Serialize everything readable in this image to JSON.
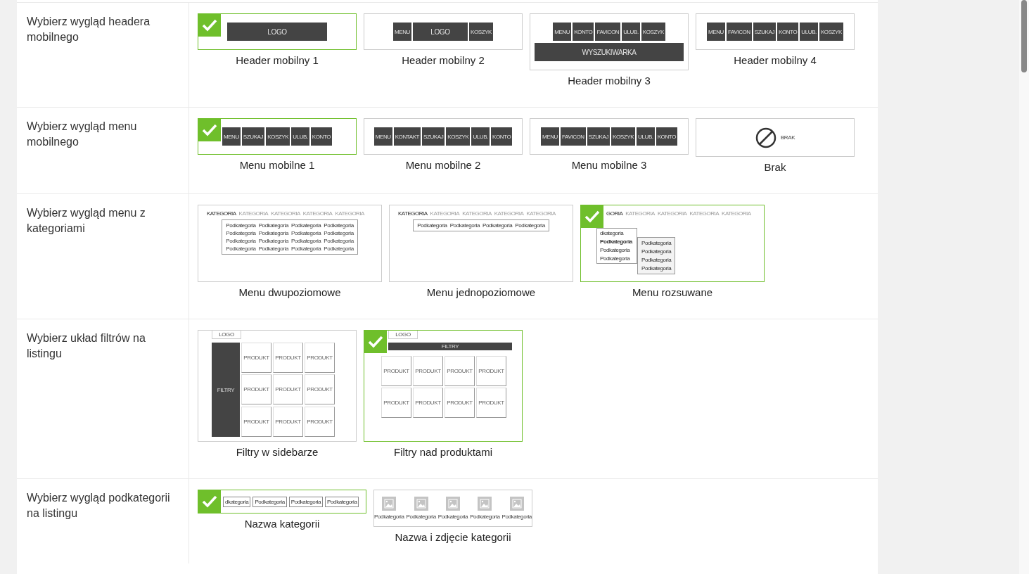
{
  "sections": [
    {
      "label": "Wybierz wygląd headera mobilnego",
      "options": [
        {
          "caption": "Header mobilny 1",
          "selected": true,
          "preview": {
            "kind": "blocks",
            "blocks": [
              {
                "text": "LOGO",
                "wide": true
              }
            ]
          }
        },
        {
          "caption": "Header mobilny 2",
          "selected": false,
          "preview": {
            "kind": "blocks",
            "blocks": [
              {
                "text": "MENU",
                "wide": false
              },
              {
                "text": "LOGO",
                "wide": true
              },
              {
                "text": "KOSZYK",
                "wide": false
              }
            ]
          }
        },
        {
          "caption": "Header mobilny 3",
          "selected": false,
          "preview": {
            "kind": "blocks",
            "blocks": [
              {
                "text": "MENU",
                "wide": false
              },
              {
                "text": "KONTO",
                "wide": false
              },
              {
                "text": "FAVICON",
                "wide": false
              },
              {
                "text": "ULUB.",
                "wide": false
              },
              {
                "text": "KOSZYK",
                "wide": false
              }
            ],
            "search_bar": "WYSZUKIWARKA"
          }
        },
        {
          "caption": "Header mobilny 4",
          "selected": false,
          "preview": {
            "kind": "blocks",
            "blocks": [
              {
                "text": "MENU",
                "wide": false
              },
              {
                "text": "FAVICON",
                "wide": false
              },
              {
                "text": "SZUKAJ",
                "wide": false
              },
              {
                "text": "KONTO",
                "wide": false
              },
              {
                "text": "ULUB.",
                "wide": false
              },
              {
                "text": "KOSZYK",
                "wide": false
              }
            ]
          }
        }
      ]
    },
    {
      "label": "Wybierz wygląd menu mobilnego",
      "options": [
        {
          "caption": "Menu mobilne 1",
          "selected": true,
          "preview": {
            "kind": "blocks",
            "blocks": [
              {
                "text": "MENU",
                "wide": false
              },
              {
                "text": "SZUKAJ",
                "wide": false
              },
              {
                "text": "KOSZYK",
                "wide": false
              },
              {
                "text": "ULUB.",
                "wide": false
              },
              {
                "text": "KONTO",
                "wide": false
              }
            ]
          }
        },
        {
          "caption": "Menu mobilne 2",
          "selected": false,
          "preview": {
            "kind": "blocks",
            "blocks": [
              {
                "text": "MENU",
                "wide": false
              },
              {
                "text": "KONTAKT",
                "wide": false
              },
              {
                "text": "SZUKAJ",
                "wide": false
              },
              {
                "text": "KOSZYK",
                "wide": false
              },
              {
                "text": "ULUB.",
                "wide": false
              },
              {
                "text": "KONTO",
                "wide": false
              }
            ]
          }
        },
        {
          "caption": "Menu mobilne 3",
          "selected": false,
          "preview": {
            "kind": "blocks",
            "blocks": [
              {
                "text": "MENU",
                "wide": false
              },
              {
                "text": "FAVICON",
                "wide": false
              },
              {
                "text": "SZUKAJ",
                "wide": false
              },
              {
                "text": "KOSZYK",
                "wide": false
              },
              {
                "text": "ULUB.",
                "wide": false
              },
              {
                "text": "KONTO",
                "wide": false
              }
            ]
          }
        },
        {
          "caption": "Brak",
          "selected": false,
          "preview": {
            "kind": "none",
            "text": "BRAK"
          }
        }
      ]
    },
    {
      "label": "Wybierz wygląd menu z kategoriami",
      "options": [
        {
          "caption": "Menu dwupoziomowe",
          "selected": false,
          "preview": {
            "kind": "mega",
            "tabs": [
              {
                "text": "KATEGORIA",
                "active": true
              },
              {
                "text": "KATEGORIA",
                "active": false
              },
              {
                "text": "KATEGORIA",
                "active": false
              },
              {
                "text": "KATEGORIA",
                "active": false
              },
              {
                "text": "KATEGORIA",
                "active": false
              }
            ],
            "columns": [
              {
                "title": "Podkategoria",
                "items": [
                  "Podkategoria",
                  "Podkategoria",
                  "Podkategoria"
                ]
              },
              {
                "title": "Podkategoria",
                "items": [
                  "Podkategoria",
                  "Podkategoria",
                  "Podkategoria"
                ]
              },
              {
                "title": "Podkategoria",
                "items": [
                  "Podkategoria",
                  "Podkategoria",
                  "Podkategoria"
                ]
              },
              {
                "title": "Podkategoria",
                "items": [
                  "Podkategoria",
                  "Podkategoria",
                  "Podkategoria"
                ]
              }
            ]
          }
        },
        {
          "caption": "Menu jednopoziomowe",
          "selected": false,
          "preview": {
            "kind": "single",
            "tabs": [
              {
                "text": "KATEGORIA",
                "active": true
              },
              {
                "text": "KATEGORIA",
                "active": false
              },
              {
                "text": "KATEGORIA",
                "active": false
              },
              {
                "text": "KATEGORIA",
                "active": false
              },
              {
                "text": "KATEGORIA",
                "active": false
              }
            ],
            "items": [
              "Podkategoria",
              "Podkategoria",
              "Podkategoria",
              "Podkategoria"
            ]
          }
        },
        {
          "caption": "Menu rozsuwane",
          "selected": true,
          "preview": {
            "kind": "dropdown",
            "tabs": [
              {
                "text": "GORIA",
                "active": true
              },
              {
                "text": "KATEGORIA",
                "active": false
              },
              {
                "text": "KATEGORIA",
                "active": false
              },
              {
                "text": "KATEGORIA",
                "active": false
              },
              {
                "text": "KATEGORIA",
                "active": false
              }
            ],
            "list": [
              {
                "text": "dkategoria",
                "active": false
              },
              {
                "text": "Podkategoria",
                "active": true
              },
              {
                "text": "Podkategoria",
                "active": false
              },
              {
                "text": "Podkategoria",
                "active": false
              }
            ],
            "flyout": [
              "Podkategoria",
              "Podkategoria",
              "Podkategoria",
              "Podkategoria"
            ]
          }
        }
      ]
    },
    {
      "label": "Wybierz układ filtrów na listingu",
      "options": [
        {
          "caption": "Filtry w sidebarze",
          "selected": false,
          "preview": {
            "kind": "sidebar",
            "logo": "LOGO",
            "filters": "FILTRY",
            "products": [
              "PRODUKT",
              "PRODUKT",
              "PRODUKT",
              "PRODUKT",
              "PRODUKT",
              "PRODUKT",
              "PRODUKT",
              "PRODUKT",
              "PRODUKT"
            ]
          }
        },
        {
          "caption": "Filtry nad produktami",
          "selected": true,
          "preview": {
            "kind": "topbar",
            "logo": "LOGO",
            "filters": "FILTRY",
            "products": [
              "PRODUKT",
              "PRODUKT",
              "PRODUKT",
              "PRODUKT",
              "PRODUKT",
              "PRODUKT",
              "PRODUKT",
              "PRODUKT"
            ]
          }
        }
      ]
    },
    {
      "label": "Wybierz wygląd podkategorii na listingu",
      "options": [
        {
          "caption": "Nazwa kategorii",
          "selected": true,
          "preview": {
            "kind": "chips",
            "items": [
              "dkategoria",
              "Podkategoria",
              "Podkategoria",
              "Podkategoria"
            ]
          }
        },
        {
          "caption": "Nazwa i zdjęcie kategorii",
          "selected": false,
          "preview": {
            "kind": "images",
            "items": [
              "Podkategoria",
              "Podkategoria",
              "Podkategoria",
              "Podkategoria",
              "Podkategoria"
            ]
          }
        }
      ]
    }
  ]
}
